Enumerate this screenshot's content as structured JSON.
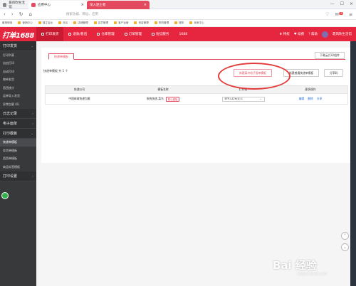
{
  "browser": {
    "tabs": [
      {
        "label": "靠风吹生活馆"
      },
      {
        "label": "应用中心"
      },
      {
        "label": "深入迷尘者"
      }
    ],
    "search_placeholder": "搜索功能、网址、应用",
    "notification_count": "15",
    "bookmarks": [
      "最常使用",
      "营销中心",
      "独立后台",
      "社区",
      "店铺管理",
      "店员管理",
      "客户运营",
      "资金管理",
      "物流管理",
      "服务",
      "卖家中心"
    ]
  },
  "appbar": {
    "logo": "打单1688",
    "nav": [
      "打印发货",
      "退款/售后",
      "仓库管理",
      "订单管理",
      "短信服务",
      "1688"
    ],
    "right": [
      "特权",
      "续费",
      "帮助",
      "靠风吹生活馆"
    ]
  },
  "sidebar": {
    "sections": [
      {
        "title": "打印发货",
        "items": [
          "打印列表",
          "自由打印",
          "自动打印",
          "物单发货",
          "西西统计",
          "运单导入发货",
          "异常包裹 (0)"
        ]
      },
      {
        "title": "日志记录",
        "items": []
      },
      {
        "title": "电子面单",
        "items": []
      },
      {
        "title": "打印模板",
        "items": [
          "快递单模板",
          "发货单模板",
          "西西单模板",
          "商品标签模板"
        ]
      },
      {
        "title": "打印设置",
        "items": []
      }
    ],
    "active_item": "快递单模板"
  },
  "main": {
    "tab_label": "快递单模板",
    "download_btn": "下载云打印组件",
    "count_label": "快递单模板",
    "count_text": "共",
    "count_value": "1",
    "count_suffix": "个",
    "buttons": [
      "新建菜鸟电子面单模板",
      "新建普通快递单模板",
      "分享码"
    ],
    "table": {
      "headers": [
        "快递公司",
        "模板名称",
        "打印机",
        "更多操作"
      ],
      "rows": [
        {
          "company": "中国邮政快递包裹",
          "template": "系统快递-菜鸟",
          "tag": "默认模板",
          "printer": "BTP-L42H(U) 1",
          "actions": [
            "编辑",
            "删除",
            "分享"
          ]
        }
      ]
    }
  },
  "watermark": {
    "text": "Bai 经验",
    "sub": "jingyan.baidu.com"
  },
  "colors": {
    "brand": "#e6263f",
    "sidebar": "#38393b",
    "annotation": "#e33a3a",
    "link": "#2b6fd6"
  }
}
